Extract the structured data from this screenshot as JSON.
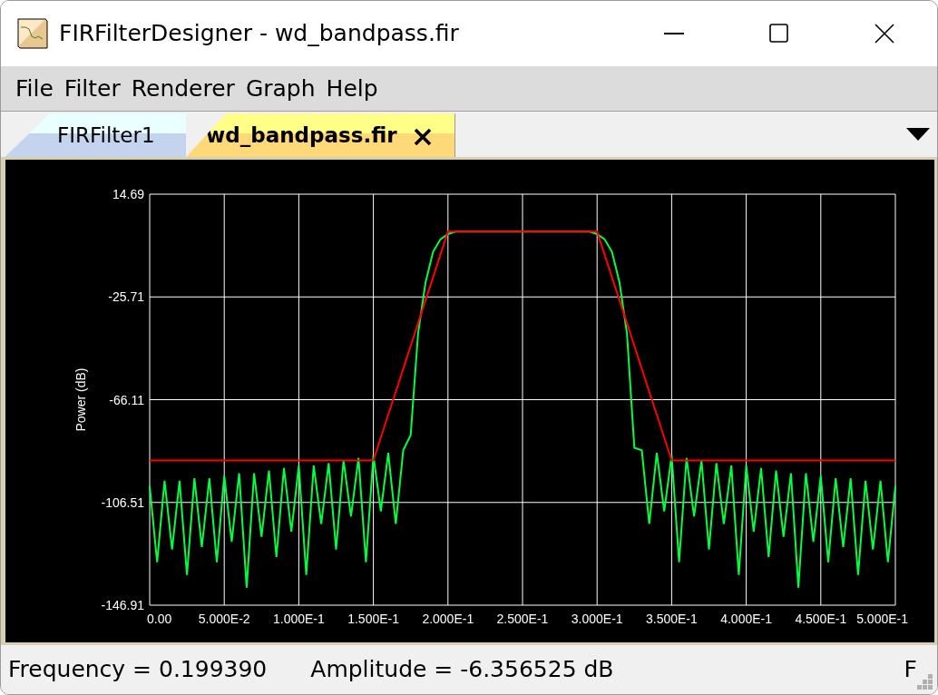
{
  "window": {
    "title": "FIRFilterDesigner - wd_bandpass.fir"
  },
  "menu": [
    "File",
    "Filter",
    "Renderer",
    "Graph",
    "Help"
  ],
  "tabs": [
    {
      "label": "FIRFilter1",
      "selected": false,
      "closable": false
    },
    {
      "label": "wd_bandpass.fir",
      "selected": true,
      "closable": true
    }
  ],
  "graph": {
    "chart_data": {
      "type": "line",
      "ylabel": "Power (dB)",
      "grid": true,
      "xlim": [
        0,
        0.5
      ],
      "ylim": [
        -146.91,
        14.69
      ],
      "xticks": [
        {
          "value": 0,
          "label": "0.00"
        },
        {
          "value": 0.05,
          "label": "5.000E-2"
        },
        {
          "value": 0.1,
          "label": "1.000E-1"
        },
        {
          "value": 0.15,
          "label": "1.500E-1"
        },
        {
          "value": 0.2,
          "label": "2.000E-1"
        },
        {
          "value": 0.25,
          "label": "2.500E-1"
        },
        {
          "value": 0.3,
          "label": "3.000E-1"
        },
        {
          "value": 0.35,
          "label": "3.500E-1"
        },
        {
          "value": 0.4,
          "label": "4.000E-1"
        },
        {
          "value": 0.45,
          "label": "4.500E-1"
        },
        {
          "value": 0.5,
          "label": "5.000E-1"
        }
      ],
      "yticks": [
        {
          "value": 14.69,
          "label": "14.69"
        },
        {
          "value": -25.71,
          "label": "-25.71"
        },
        {
          "value": -66.11,
          "label": "-66.11"
        },
        {
          "value": -106.51,
          "label": "-106.51"
        },
        {
          "value": -146.91,
          "label": "-146.91"
        }
      ],
      "x": [
        0,
        0.005,
        0.01,
        0.015,
        0.02,
        0.025,
        0.03,
        0.035,
        0.04,
        0.045,
        0.05,
        0.055,
        0.06,
        0.065,
        0.07,
        0.075,
        0.08,
        0.085,
        0.09,
        0.095,
        0.1,
        0.105,
        0.11,
        0.115,
        0.12,
        0.125,
        0.13,
        0.135,
        0.14,
        0.145,
        0.15,
        0.155,
        0.16,
        0.165,
        0.17,
        0.175,
        0.18,
        0.185,
        0.19,
        0.195,
        0.2,
        0.205,
        0.21,
        0.215,
        0.22,
        0.225,
        0.23,
        0.235,
        0.24,
        0.245,
        0.25,
        0.255,
        0.26,
        0.265,
        0.27,
        0.275,
        0.28,
        0.285,
        0.29,
        0.295,
        0.3,
        0.305,
        0.31,
        0.315,
        0.32,
        0.325,
        0.33,
        0.335,
        0.34,
        0.345,
        0.35,
        0.355,
        0.36,
        0.365,
        0.37,
        0.375,
        0.38,
        0.385,
        0.39,
        0.395,
        0.4,
        0.405,
        0.41,
        0.415,
        0.42,
        0.425,
        0.43,
        0.435,
        0.44,
        0.445,
        0.45,
        0.455,
        0.46,
        0.465,
        0.47,
        0.475,
        0.48,
        0.485,
        0.49,
        0.495,
        0.5
      ],
      "series": [
        {
          "color": "#00ff40",
          "values": [
            -100,
            -130,
            -98,
            -125,
            -98,
            -135,
            -97,
            -124,
            -97,
            -130,
            -96,
            -122,
            -95,
            -140,
            -95,
            -120,
            -94,
            -128,
            -93,
            -118,
            -92,
            -135,
            -92,
            -115,
            -91,
            -125,
            -90,
            -112,
            -89,
            -130,
            -88,
            -110,
            -87,
            -115,
            -86,
            -80,
            -40,
            -20,
            -8,
            -3,
            -1,
            0,
            0,
            0,
            0,
            0,
            0,
            0,
            0,
            0,
            0,
            0,
            0,
            0,
            0,
            0,
            0,
            0,
            0,
            0,
            -1,
            -3,
            -8,
            -20,
            -40,
            -85,
            -86,
            -115,
            -87,
            -110,
            -88,
            -130,
            -89,
            -112,
            -90,
            -125,
            -91,
            -115,
            -92,
            -135,
            -92,
            -118,
            -93,
            -128,
            -94,
            -120,
            -95,
            -140,
            -95,
            -122,
            -96,
            -130,
            -97,
            -124,
            -97,
            -135,
            -98,
            -125,
            -98,
            -130,
            -100
          ]
        },
        {
          "color": "#ff0000",
          "values": [
            -90,
            -90,
            -90,
            -90,
            -90,
            -90,
            -90,
            -90,
            -90,
            -90,
            -90,
            -90,
            -90,
            -90,
            -90,
            -90,
            -90,
            -90,
            -90,
            -90,
            -90,
            -90,
            -90,
            -90,
            -90,
            -90,
            -90,
            -90,
            -90,
            -90,
            -90,
            -81,
            -72,
            -63,
            -54,
            -45,
            -36,
            -27,
            -18,
            -9,
            0,
            0,
            0,
            0,
            0,
            0,
            0,
            0,
            0,
            0,
            0,
            0,
            0,
            0,
            0,
            0,
            0,
            0,
            0,
            0,
            0,
            -9,
            -18,
            -27,
            -36,
            -45,
            -54,
            -63,
            -72,
            -81,
            -90,
            -90,
            -90,
            -90,
            -90,
            -90,
            -90,
            -90,
            -90,
            -90,
            -90,
            -90,
            -90,
            -90,
            -90,
            -90,
            -90,
            -90,
            -90,
            -90,
            -90,
            -90,
            -90,
            -90,
            -90,
            -90,
            -90,
            -90,
            -90,
            -90,
            -90
          ]
        }
      ]
    }
  },
  "status_bar": [
    "Frequency = 0.199390",
    "Amplitude = -6.356525 dB",
    "F"
  ]
}
